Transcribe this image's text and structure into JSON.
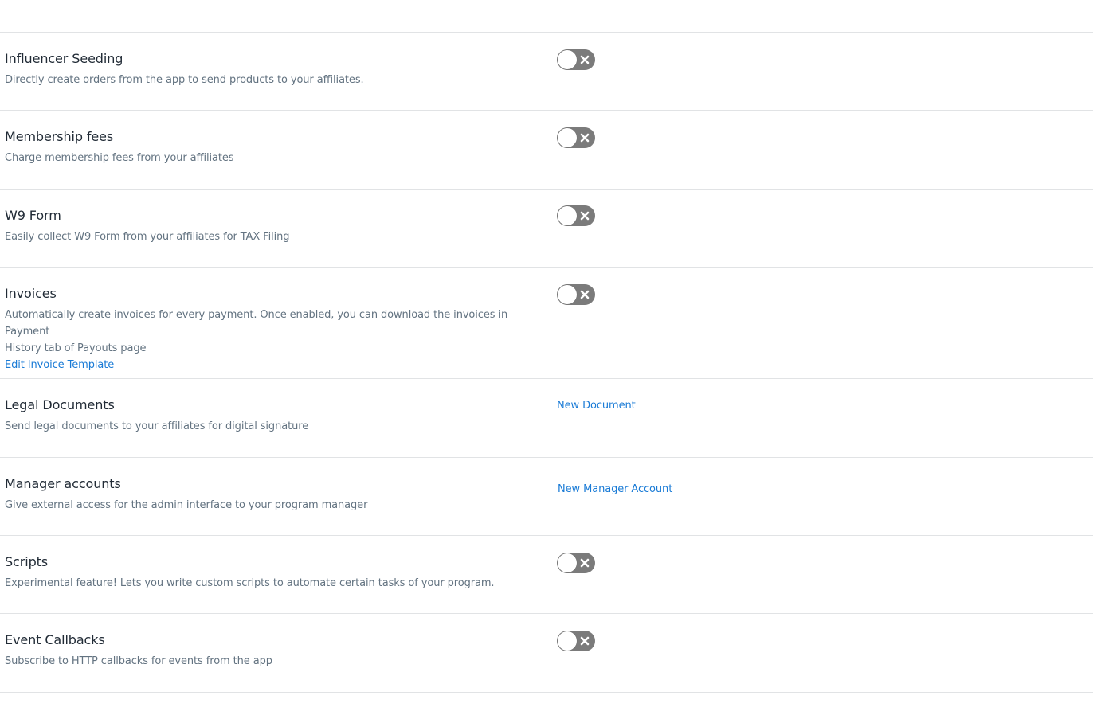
{
  "settings": [
    {
      "title": "Influencer Seeding",
      "description": "Directly create orders from the app to send products to your affiliates.",
      "control": "toggle",
      "enabled": false
    },
    {
      "title": "Membership fees",
      "description": "Charge membership fees from your affiliates",
      "control": "toggle",
      "enabled": false
    },
    {
      "title": "W9 Form",
      "description": "Easily collect W9 Form from your affiliates for TAX Filing",
      "control": "toggle",
      "enabled": false
    },
    {
      "title": "Invoices",
      "description_line1": "Automatically create invoices for every payment. Once enabled, you can download the invoices in Payment",
      "description_line2": "History tab of Payouts page",
      "link_label": "Edit Invoice Template",
      "control": "toggle",
      "enabled": false
    },
    {
      "title": "Legal Documents",
      "description": "Send legal documents to your affiliates for digital signature",
      "control": "link",
      "control_label": "New Document"
    },
    {
      "title": "Manager accounts",
      "description": "Give external access for the admin interface to your program manager",
      "control": "link",
      "control_label": "New Manager Account"
    },
    {
      "title": "Scripts",
      "description": "Experimental feature! Lets you write custom scripts to automate certain tasks of your program.",
      "control": "toggle",
      "enabled": false
    },
    {
      "title": "Event Callbacks",
      "description": "Subscribe to HTTP callbacks for events from the app",
      "control": "toggle",
      "enabled": false
    }
  ],
  "colors": {
    "toggle_off": "#7b7b7b",
    "link": "#1a7bd6",
    "divider": "#e1e3e5",
    "text_primary": "#212b36",
    "text_secondary": "#637381"
  }
}
